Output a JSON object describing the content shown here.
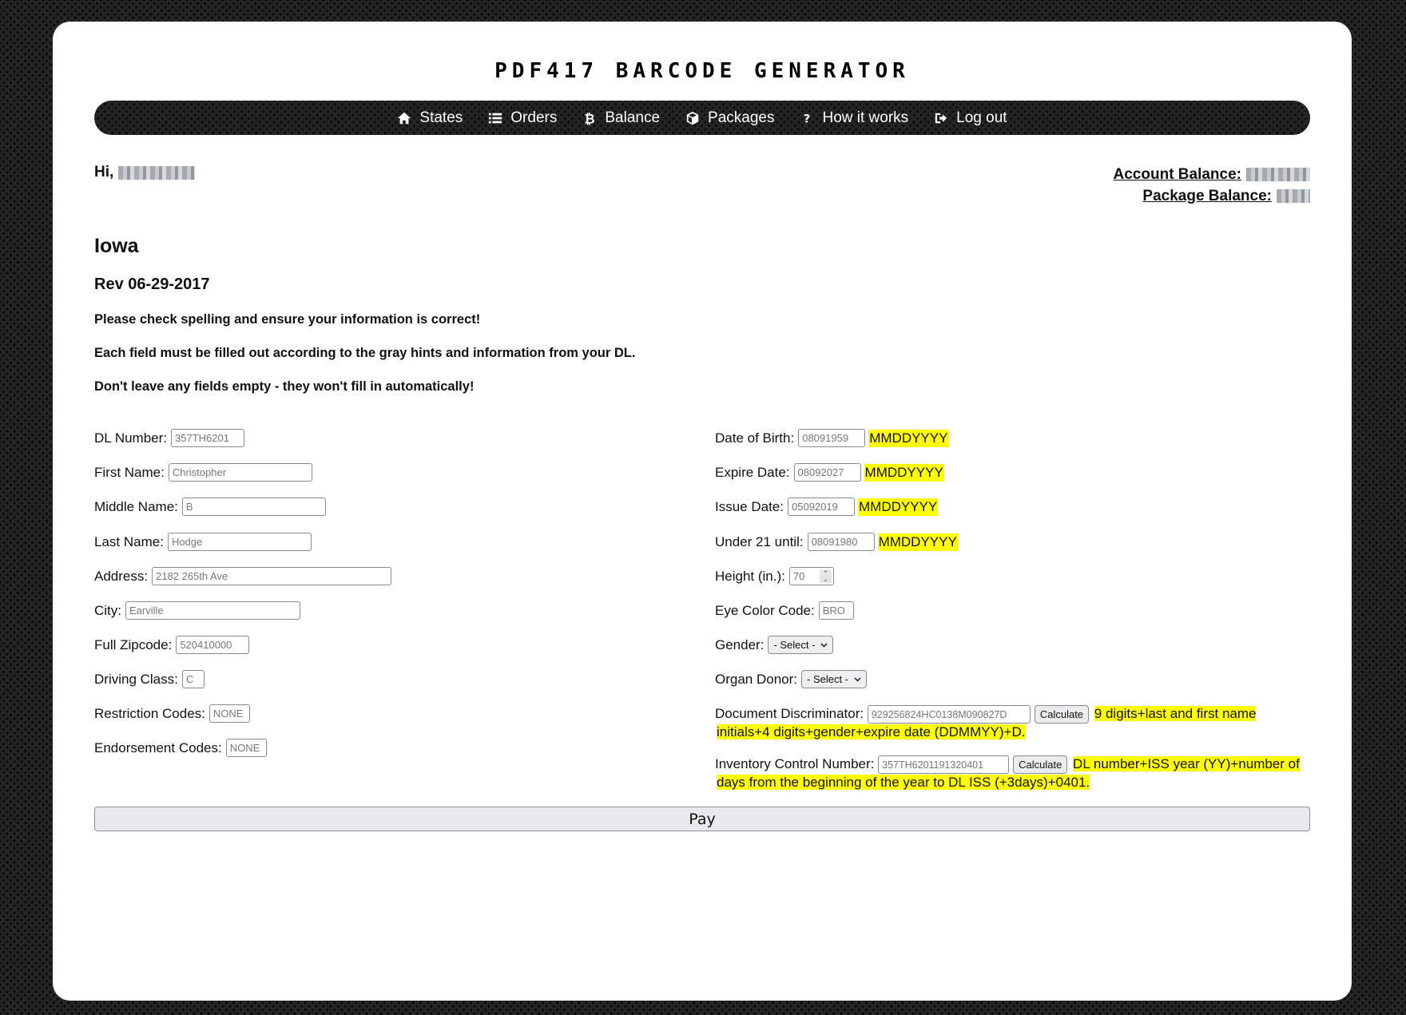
{
  "header": {
    "site_title": "PDF417 BARCODE GENERATOR"
  },
  "nav": {
    "items": [
      {
        "label": "States",
        "icon": "home-icon"
      },
      {
        "label": "Orders",
        "icon": "list-icon"
      },
      {
        "label": "Balance",
        "icon": "bitcoin-icon"
      },
      {
        "label": "Packages",
        "icon": "package-icon"
      },
      {
        "label": "How it works",
        "icon": "question-icon"
      },
      {
        "label": "Log out",
        "icon": "logout-icon"
      }
    ]
  },
  "user": {
    "greeting": "Hi,",
    "account_balance_label": "Account Balance:",
    "package_balance_label": "Package Balance:"
  },
  "page": {
    "state": "Iowa",
    "revision": "Rev 06-29-2017",
    "notes": [
      "Please check spelling and ensure your information is correct!",
      "Each field must be filled out according to the gray hints and information from your DL.",
      "Don't leave any fields empty - they won't fill in automatically!"
    ]
  },
  "form": {
    "left": {
      "dl_number": {
        "label": "DL Number:",
        "placeholder": "357TH6201"
      },
      "first_name": {
        "label": "First Name:",
        "placeholder": "Christopher"
      },
      "middle_name": {
        "label": "Middle Name:",
        "placeholder": "B"
      },
      "last_name": {
        "label": "Last Name:",
        "placeholder": "Hodge"
      },
      "address": {
        "label": "Address:",
        "placeholder": "2182 265th Ave"
      },
      "city": {
        "label": "City:",
        "placeholder": "Earville"
      },
      "zipcode": {
        "label": "Full Zipcode:",
        "placeholder": "520410000"
      },
      "driving_class": {
        "label": "Driving Class:",
        "placeholder": "C"
      },
      "restriction_codes": {
        "label": "Restriction Codes:",
        "placeholder": "NONE"
      },
      "endorsement_codes": {
        "label": "Endorsement Codes:",
        "placeholder": "NONE"
      }
    },
    "right": {
      "dob": {
        "label": "Date of Birth:",
        "placeholder": "08091959",
        "hint": "MMDDYYYY"
      },
      "expire_date": {
        "label": "Expire Date:",
        "placeholder": "08092027",
        "hint": "MMDDYYYY"
      },
      "issue_date": {
        "label": "Issue Date:",
        "placeholder": "05092019",
        "hint": "MMDDYYYY"
      },
      "under21": {
        "label": "Under 21 until:",
        "placeholder": "08091980",
        "hint": "MMDDYYYY"
      },
      "height": {
        "label": "Height (in.):",
        "placeholder": "70"
      },
      "eye_color": {
        "label": "Eye Color Code:",
        "placeholder": "BRO"
      },
      "gender": {
        "label": "Gender:",
        "selected": "- Select -"
      },
      "organ_donor": {
        "label": "Organ Donor:",
        "selected": "- Select -"
      },
      "doc_discriminator": {
        "label": "Document Discriminator:",
        "placeholder": "929256824HC0138M090827D",
        "button": "Calculate",
        "hint": "9 digits+last and first name initials+4 digits+gender+expire date (DDMMYY)+D."
      },
      "inventory_control": {
        "label": "Inventory Control Number:",
        "placeholder": "357TH6201191320401",
        "button": "Calculate",
        "hint": "DL number+ISS year (YY)+number of days from the beginning of the year to DL ISS (+3days)+0401."
      }
    },
    "submit_label": "Pay"
  },
  "colors": {
    "hint_highlight": "#ffff00",
    "background": "#252525",
    "card": "#ffffff"
  }
}
